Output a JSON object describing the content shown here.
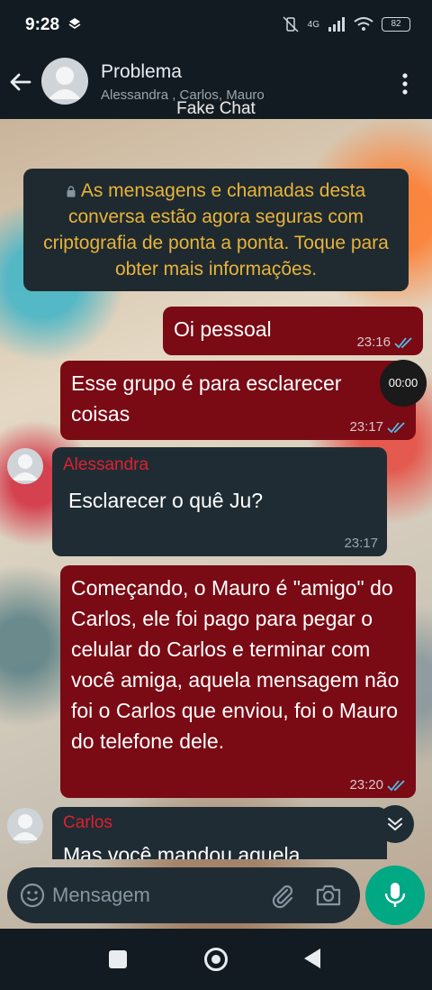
{
  "status_bar": {
    "time": "9:28",
    "network": "4G",
    "battery": "82"
  },
  "header": {
    "title": "Problema",
    "participants": "Alessandra , Carlos, Mauro"
  },
  "watermark": "Fake Chat",
  "system_message": "As mensagens e chamadas desta conversa estão agora seguras com criptografia de ponta a ponta. Toque para obter mais informações.",
  "messages": [
    {
      "direction": "out",
      "text": "Oi pessoal",
      "time": "23:16",
      "status": "read"
    },
    {
      "direction": "out",
      "text": "Esse grupo é para esclarecer coisas",
      "time": "23:17",
      "status": "read"
    },
    {
      "direction": "in",
      "sender": "Alessandra",
      "text": "Esclarecer o quê Ju?",
      "time": "23:17"
    },
    {
      "direction": "out",
      "text": "Começando, o Mauro é \"amigo\" do Carlos, ele foi pago para pegar o celular do Carlos e terminar com você amiga, aquela mensagem não foi o Carlos que enviou, foi o Mauro do telefone dele.",
      "time": "23:20",
      "status": "read"
    },
    {
      "direction": "in",
      "sender": "Carlos",
      "text": "Mas você mandou aquela"
    }
  ],
  "timer_label": "00:00",
  "input": {
    "placeholder": "Mensagem"
  },
  "colors": {
    "outgoing_bubble": "#7a0a14",
    "incoming_bubble": "#1f2c34",
    "accent": "#00a884",
    "sender_name": "#e0202e",
    "read_ticks": "#53bdeb"
  },
  "icons": [
    "back-arrow-icon",
    "avatar-icon",
    "menu-dots-icon",
    "lock-icon",
    "double-check-icon",
    "chevron-down-icon",
    "emoji-icon",
    "paperclip-icon",
    "camera-icon",
    "mic-icon"
  ]
}
